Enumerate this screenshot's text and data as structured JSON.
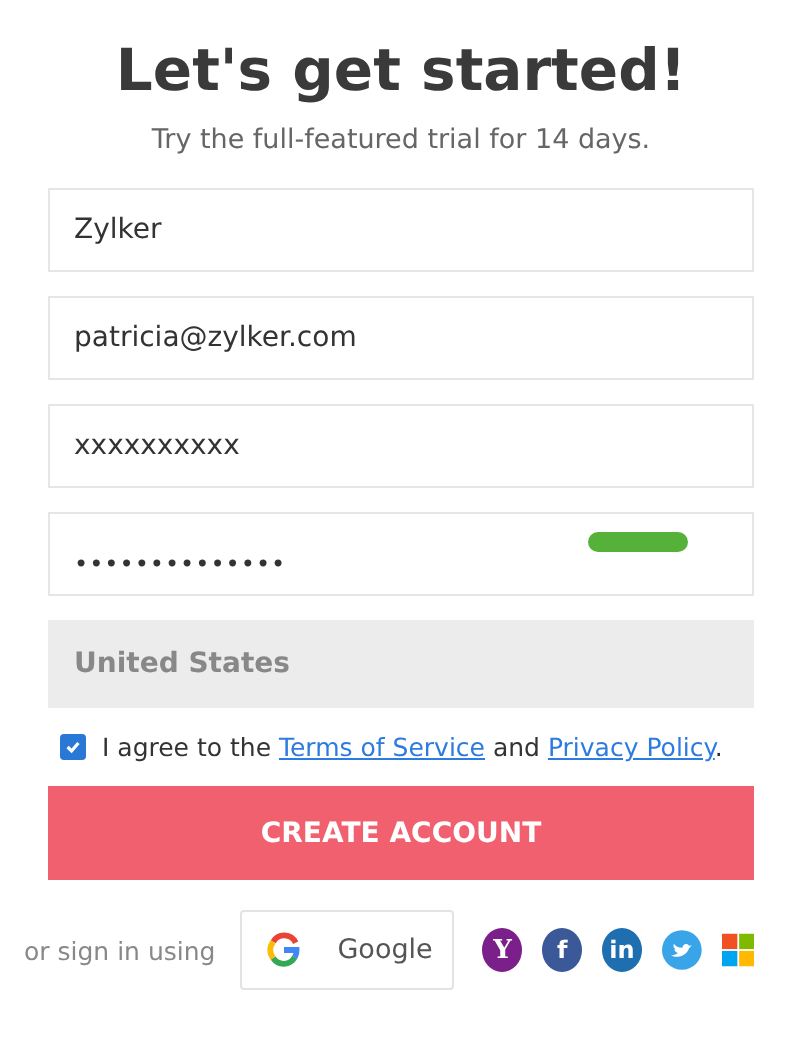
{
  "title": "Let's get started!",
  "subtitle": "Try the full-featured trial for 14 days.",
  "fields": [
    {
      "kind": "text",
      "value": "Zylker"
    },
    {
      "kind": "text",
      "value": "patricia@zylker.com"
    },
    {
      "kind": "text",
      "value": "xxxxxxxxxx"
    },
    {
      "kind": "password",
      "value": "••••••••••••••",
      "strong": true
    },
    {
      "kind": "select",
      "value": "United States"
    }
  ],
  "agree": {
    "checked": true,
    "before": "I agree to the",
    "link1": "Terms of Service",
    "middle": "and",
    "link2": "Privacy Policy",
    "after": "."
  },
  "submit": "CREATE ACCOUNT",
  "social": {
    "label": "or sign in using",
    "google": "Google",
    "icons": [
      {
        "kind": "yahoo",
        "glyph": "Y"
      },
      {
        "kind": "facebook",
        "glyph": "f"
      },
      {
        "kind": "linkedin",
        "glyph": "in"
      },
      {
        "kind": "twitter"
      },
      {
        "kind": "microsoft"
      }
    ]
  }
}
